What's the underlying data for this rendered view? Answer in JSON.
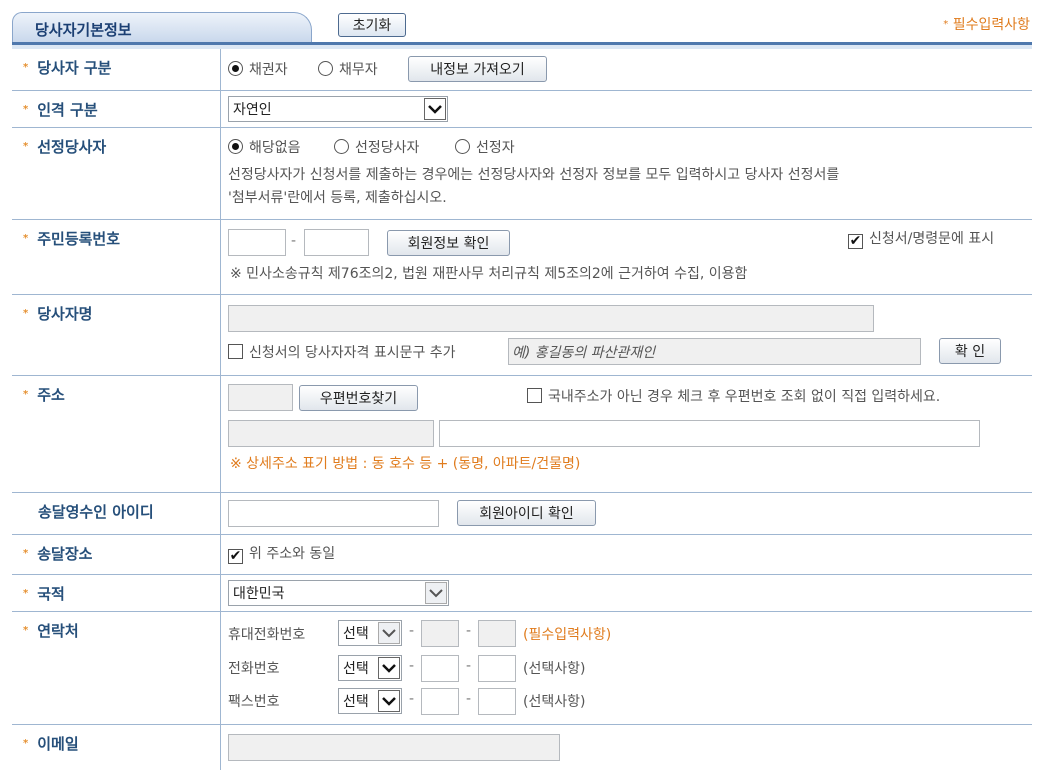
{
  "header": {
    "title": "당사자기본정보",
    "reset_label": "초기화",
    "required_note": "필수입력사항"
  },
  "party_type": {
    "label": "당사자 구분",
    "options": [
      "채권자",
      "채무자"
    ],
    "selected": "채권자",
    "import_button": "내정보 가져오기"
  },
  "personality": {
    "label": "인격 구분",
    "value": "자연인"
  },
  "designated": {
    "label": "선정당사자",
    "options": [
      "해당없음",
      "선정당사자",
      "선정자"
    ],
    "selected": "해당없음",
    "note_line1": "선정당사자가 신청서를 제출하는 경우에는 선정당사자와 선정자 정보를 모두 입력하시고 당사자 선정서를",
    "note_line2": "'첨부서류'란에서 등록, 제출하십시오."
  },
  "resident_no": {
    "label": "주민등록번호",
    "first": "",
    "second": "",
    "verify_button": "회원정보 확인",
    "display_check_label": "신청서/명령문에 표시",
    "display_checked": true,
    "note": "※ 민사소송규칙 제76조의2, 법원 재판사무 처리규칙 제5조의2에 근거하여 수집, 이용함"
  },
  "party_name": {
    "label": "당사자명",
    "name_value": "",
    "qualification_check_label": "신청서의 당사자자격 표시문구 추가",
    "qualification_placeholder": "예) 홍길동의 파산관재인",
    "confirm_button": "확 인"
  },
  "address": {
    "label": "주소",
    "zip_value": "",
    "zip_button": "우편번호찾기",
    "foreign_check_label": "국내주소가 아닌 경우 체크 후 우편번호 조회 없이 직접 입력하세요.",
    "hint": "※ 상세주소 표기 방법 : 동 호수 등 + (동명, 아파트/건물명)"
  },
  "delivery_receiver": {
    "label": "송달영수인 아이디",
    "value": "",
    "verify_button": "회원아이디 확인"
  },
  "delivery_place": {
    "label": "송달장소",
    "same_label": "위 주소와 동일",
    "checked": true
  },
  "nationality": {
    "label": "국적",
    "value": "대한민국"
  },
  "contact": {
    "label": "연락처",
    "rows": [
      {
        "name": "휴대전화번호",
        "select": "선택",
        "note": "(필수입력사항)"
      },
      {
        "name": "전화번호",
        "select": "선택",
        "note": "(선택사항)"
      },
      {
        "name": "팩스번호",
        "select": "선택",
        "note": "(선택사항)"
      }
    ]
  },
  "email": {
    "label": "이메일",
    "value": ""
  },
  "icons": {
    "star": "*",
    "check": "✔",
    "dropdown": "chevron-down-icon"
  },
  "colors": {
    "accent": "#4f78ad",
    "label": "#264f7a",
    "required": "#e07c1e"
  }
}
